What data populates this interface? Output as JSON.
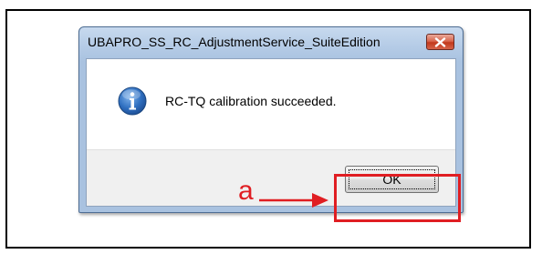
{
  "dialog": {
    "title": "UBAPRO_SS_RC_AdjustmentService_SuiteEdition",
    "close_icon": "close-icon",
    "icon": "info-icon",
    "message": "RC-TQ calibration succeeded.",
    "ok_label": "OK"
  },
  "annotation": {
    "label": "a",
    "color": "#e01e23"
  },
  "colors": {
    "close_button": "#c2391c",
    "info_icon": "#2f6fc0",
    "callout": "#e01e23"
  }
}
